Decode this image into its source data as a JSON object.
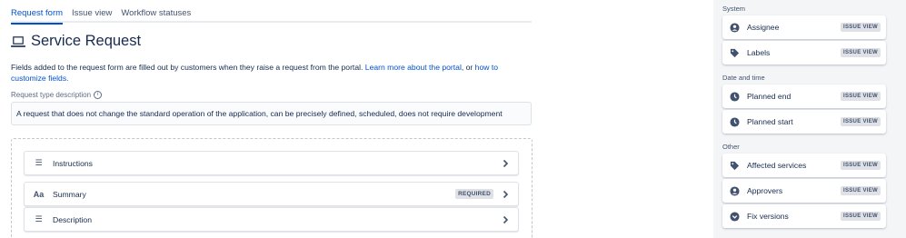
{
  "tabs": [
    {
      "label": "Request form",
      "active": true
    },
    {
      "label": "Issue view",
      "active": false
    },
    {
      "label": "Workflow statuses",
      "active": false
    }
  ],
  "title": "Service Request",
  "title_icon": "laptop-icon",
  "intro": {
    "text": "Fields added to the request form are filled out by customers when they raise a request from the portal. ",
    "link1": "Learn more about the portal",
    "or": ", or ",
    "link2": "how to customize fields."
  },
  "description": {
    "label": "Request type description",
    "value": "A request that does not change the standard operation of the application, can be precisely defined, scheduled, does not require development"
  },
  "form_fields": [
    {
      "label": "Instructions",
      "icon": "paragraph-icon",
      "required": false
    },
    {
      "label": "Summary",
      "icon": "text-format-icon",
      "required": true,
      "badge": "REQUIRED"
    },
    {
      "label": "Description",
      "icon": "paragraph-icon",
      "required": false
    }
  ],
  "panel": {
    "groups": [
      {
        "label": "System",
        "items": [
          {
            "label": "Assignee",
            "icon": "person-circle-icon",
            "badge": "ISSUE VIEW"
          },
          {
            "label": "Labels",
            "icon": "tag-icon",
            "badge": "ISSUE VIEW"
          }
        ]
      },
      {
        "label": "Date and time",
        "items": [
          {
            "label": "Planned end",
            "icon": "clock-icon",
            "badge": "ISSUE VIEW"
          },
          {
            "label": "Planned start",
            "icon": "clock-icon",
            "badge": "ISSUE VIEW"
          }
        ]
      },
      {
        "label": "Other",
        "items": [
          {
            "label": "Affected services",
            "icon": "tag-icon",
            "badge": "ISSUE VIEW"
          },
          {
            "label": "Approvers",
            "icon": "person-circle-icon",
            "badge": "ISSUE VIEW"
          },
          {
            "label": "Fix versions",
            "icon": "check-circle-icon",
            "badge": "ISSUE VIEW"
          }
        ]
      }
    ]
  }
}
